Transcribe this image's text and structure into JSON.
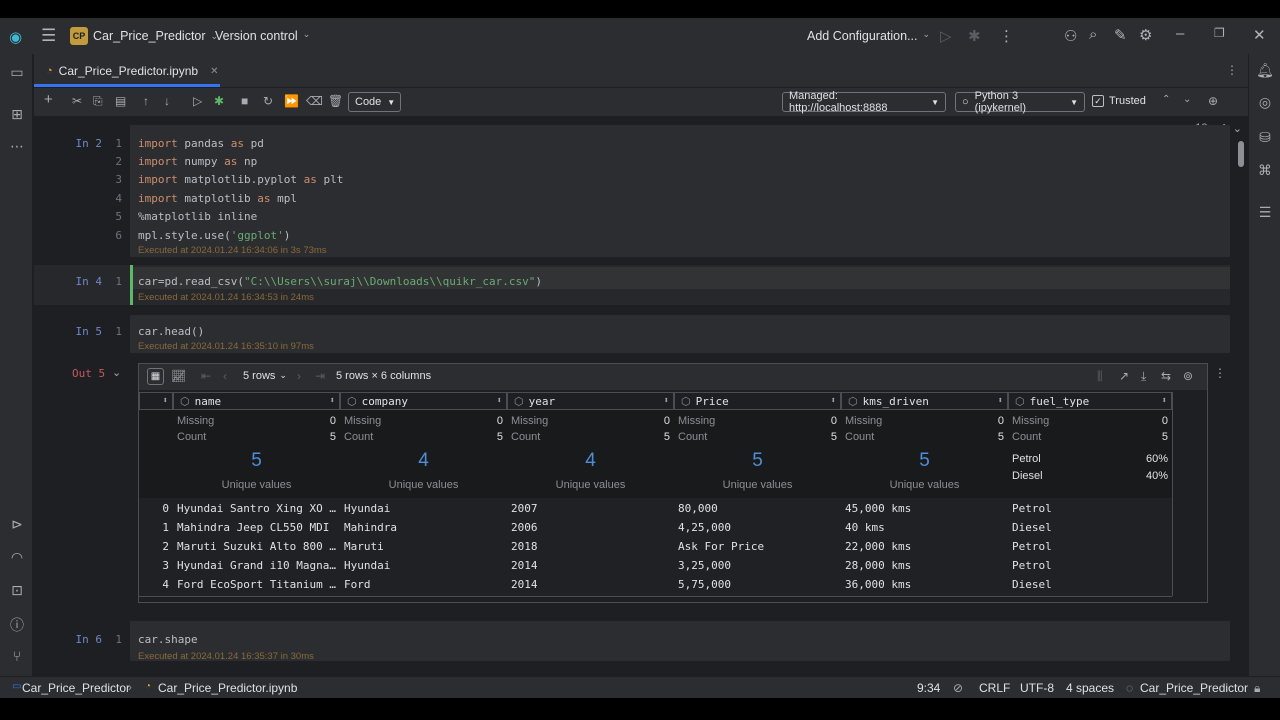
{
  "window": {
    "project_badge": "CP",
    "project_name": "Car_Price_Predictor",
    "vcs_label": "Version control",
    "config_label": "Add Configuration..."
  },
  "tab": {
    "file_name": "Car_Price_Predictor.ipynb"
  },
  "toolbar": {
    "cell_type": "Code",
    "server": "Managed: http://localhost:8888",
    "kernel": "Python 3 (ipykernel)",
    "trusted_label": "Trusted",
    "trusted_checked": true
  },
  "editor": {
    "inspection_count": "13"
  },
  "cells": [
    {
      "label": "In 2",
      "lines": [
        "1",
        "2",
        "3",
        "4",
        "5",
        "6"
      ],
      "exec": "Executed at 2024.01.24 16:34:06 in 3s 73ms"
    },
    {
      "label": "In 4",
      "lines": [
        "1"
      ],
      "exec": "Executed at 2024.01.24 16:34:53 in 24ms"
    },
    {
      "label": "In 5",
      "lines": [
        "1"
      ],
      "code": "car.head()",
      "exec": "Executed at 2024.01.24 16:35:10 in 97ms"
    },
    {
      "label": "In 6",
      "lines": [
        "1"
      ],
      "code": "car.shape",
      "exec": "Executed at 2024.01.24 16:35:37 in 30ms"
    }
  ],
  "code_cell2": {
    "l1": [
      "import",
      " pandas ",
      "as",
      " pd"
    ],
    "l2": [
      "import",
      " numpy ",
      "as",
      " np"
    ],
    "l3": [
      "import",
      " matplotlib.pyplot ",
      "as",
      " plt"
    ],
    "l4": [
      "import",
      " matplotlib ",
      "as",
      " mpl"
    ],
    "l5": "%matplotlib inline",
    "l6": [
      "mpl.style.use(",
      "'ggplot'",
      ")"
    ]
  },
  "code_cell4": {
    "prefix": "car=pd.read_csv(",
    "string": "\"C:\\\\Users\\\\suraj\\\\Downloads\\\\quikr_car.csv\"",
    "suffix": ")"
  },
  "output": {
    "label": "Out 5",
    "rows_selector": "5 rows",
    "shape": "5 rows × 6 columns",
    "columns": [
      "name",
      "company",
      "year",
      "Price",
      "kms_driven",
      "fuel_type"
    ],
    "missing_label": "Missing",
    "count_label": "Count",
    "unique_label": "Unique values",
    "missing": [
      "0",
      "0",
      "0",
      "0",
      "0",
      "0"
    ],
    "count": [
      "5",
      "5",
      "5",
      "5",
      "5",
      "5"
    ],
    "unique": [
      "5",
      "4",
      "4",
      "5",
      "5"
    ],
    "fuel_dist": [
      {
        "value": "Petrol",
        "pct": "60%"
      },
      {
        "value": "Diesel",
        "pct": "40%"
      }
    ],
    "index": [
      "0",
      "1",
      "2",
      "3",
      "4"
    ],
    "rows": [
      [
        "Hyundai Santro Xing XO …",
        "Hyundai",
        "2007",
        "80,000",
        "45,000 kms",
        "Petrol"
      ],
      [
        "Mahindra Jeep CL550 MDI",
        "Mahindra",
        "2006",
        "4,25,000",
        "40 kms",
        "Diesel"
      ],
      [
        "Maruti Suzuki Alto 800 …",
        "Maruti",
        "2018",
        "Ask For Price",
        "22,000 kms",
        "Petrol"
      ],
      [
        "Hyundai Grand i10 Magna…",
        "Hyundai",
        "2014",
        "3,25,000",
        "28,000 kms",
        "Petrol"
      ],
      [
        "Ford EcoSport Titanium …",
        "Ford",
        "2014",
        "5,75,000",
        "36,000 kms",
        "Diesel"
      ]
    ]
  },
  "status": {
    "crumb_project": "Car_Price_Predictor",
    "crumb_file": "Car_Price_Predictor.ipynb",
    "position": "9:34",
    "line_sep": "CRLF",
    "encoding": "UTF-8",
    "indent": "4 spaces",
    "interpreter": "Car_Price_Predictor"
  }
}
